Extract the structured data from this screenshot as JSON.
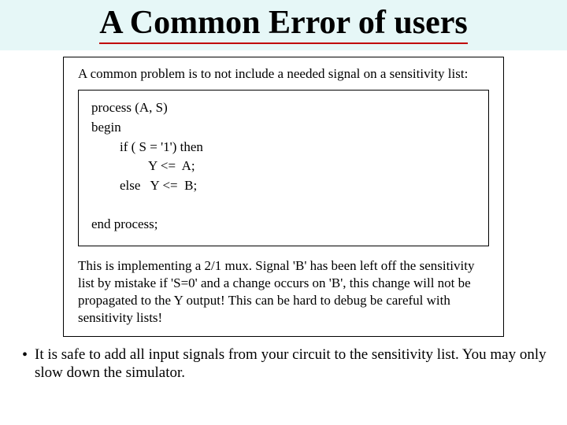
{
  "title": "A Common Error of users",
  "intro": "A common problem is to not include a needed signal on a sensitivity list:",
  "code": {
    "l1": "process (A, S)",
    "l2": "begin",
    "l3": "if ( S = '1') then",
    "l4": "Y <=  A;",
    "l5": "else   Y <=  B;",
    "blank": " ",
    "l6": "end process;"
  },
  "explain": "This is implementing a 2/1 mux.  Signal 'B' has been left off the sensitivity list by mistake   if 'S=0' and a change occurs on 'B', this change will not be propagated to the Y output! This can be hard to debug   be careful with sensitivity lists!",
  "bullet": "It is safe to add all input signals from your circuit to the sensitivity list. You may only slow down the simulator."
}
